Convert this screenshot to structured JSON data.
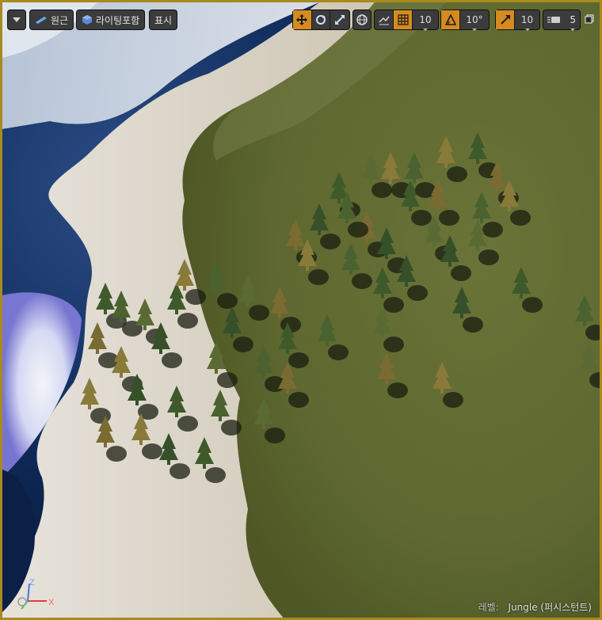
{
  "toolbar": {
    "perspective_label": "원근",
    "lighting_label": "라이팅포함",
    "show_label": "표시",
    "grid_snap_value": "10",
    "rotation_snap_value": "10°",
    "scale_snap_value": "10",
    "camera_speed_value": "5"
  },
  "status": {
    "level_label": "레벨:",
    "level_value": "Jungle (퍼시스턴트)"
  },
  "gizmo": {
    "z_label": "Z",
    "x_label": "X"
  },
  "colors": {
    "active_orange": "#d58b1f",
    "viewport_border": "#a88a1e",
    "axis_x": "#e83a3a",
    "axis_y": "#3ad04a",
    "axis_z": "#3a7ae8"
  },
  "icons": [
    "dropdown-icon",
    "perspective-icon",
    "lighting-icon",
    "translate-icon",
    "rotate-icon",
    "scale-icon",
    "world-icon",
    "surface-snap-icon",
    "grid-icon",
    "rotation-snap-icon",
    "scale-snap-icon",
    "camera-speed-icon",
    "maximize-icon"
  ]
}
